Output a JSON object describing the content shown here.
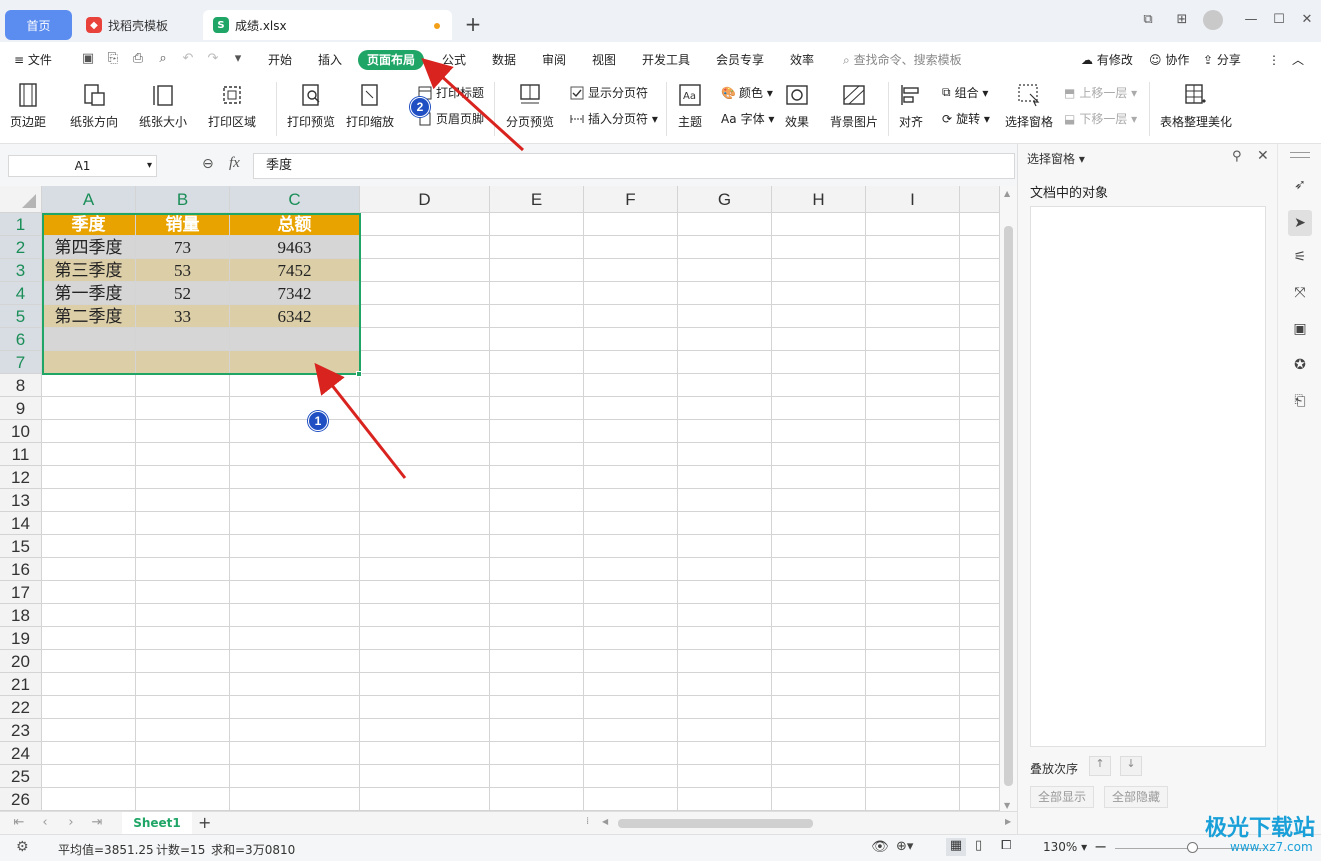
{
  "titlebar": {
    "tabs": [
      {
        "label": "首页"
      },
      {
        "label": "找稻壳模板"
      },
      {
        "label": "成绩.xlsx"
      }
    ],
    "add_tab": "+"
  },
  "menubar": {
    "file": "文件",
    "items": [
      "开始",
      "插入",
      "页面布局",
      "公式",
      "数据",
      "审阅",
      "视图",
      "开发工具",
      "会员专享",
      "效率"
    ],
    "search_placeholder": "查找命令、搜索模板",
    "has_changes": "有修改",
    "collaborate": "协作",
    "share": "分享"
  },
  "ribbon": {
    "margins": "页边距",
    "orientation": "纸张方向",
    "size": "纸张大小",
    "print_area": "打印区域",
    "print_preview": "打印预览",
    "print_scale": "打印缩放",
    "print_titles": "打印标题",
    "header_footer": "页眉页脚",
    "page_break_preview": "分页预览",
    "show_page_breaks": "显示分页符",
    "insert_page_break": "插入分页符",
    "theme": "主题",
    "colors": "颜色",
    "fonts": "字体",
    "effects": "效果",
    "background": "背景图片",
    "align": "对齐",
    "group": "组合",
    "rotate": "旋转",
    "selection_pane": "选择窗格",
    "bring_forward": "上移一层",
    "send_backward": "下移一层",
    "beautify": "表格整理美化"
  },
  "formulabar": {
    "name_box": "A1",
    "fx": "fx",
    "content": "季度"
  },
  "grid": {
    "columns": [
      "A",
      "B",
      "C",
      "D",
      "E",
      "F",
      "G",
      "H",
      "I"
    ],
    "rows": [
      "1",
      "2",
      "3",
      "4",
      "5",
      "6",
      "7",
      "8",
      "9",
      "10",
      "11",
      "12",
      "13",
      "14",
      "15",
      "16",
      "17",
      "18",
      "19",
      "20",
      "21",
      "22",
      "23",
      "24",
      "25",
      "26"
    ],
    "table_header": [
      "季度",
      "销量",
      "总额"
    ],
    "table_rows": [
      [
        "第四季度",
        "73",
        "9463"
      ],
      [
        "第三季度",
        "53",
        "7452"
      ],
      [
        "第一季度",
        "52",
        "7342"
      ],
      [
        "第二季度",
        "33",
        "6342"
      ]
    ]
  },
  "sheets": {
    "active": "Sheet1",
    "add": "+"
  },
  "status": {
    "average": "平均值=3851.25",
    "count": "计数=15",
    "sum": "求和=3万0810",
    "zoom": "130%"
  },
  "selection_pane": {
    "title": "选择窗格",
    "objects_label": "文档中的对象",
    "order_label": "叠放次序",
    "show_all": "全部显示",
    "hide_all": "全部隐藏"
  },
  "annotations": {
    "badge1": "1",
    "badge2": "2",
    "arrow_color": "#d9231f",
    "badge_color": "#1f4fc3"
  },
  "watermark": {
    "text": "极光下载站",
    "url": "www.xz7.com"
  },
  "colors": {
    "accent": "#1fa566",
    "header_fill": "#e8a300",
    "band_gray": "#d6d6d6",
    "band_tan": "#dccfa8"
  }
}
